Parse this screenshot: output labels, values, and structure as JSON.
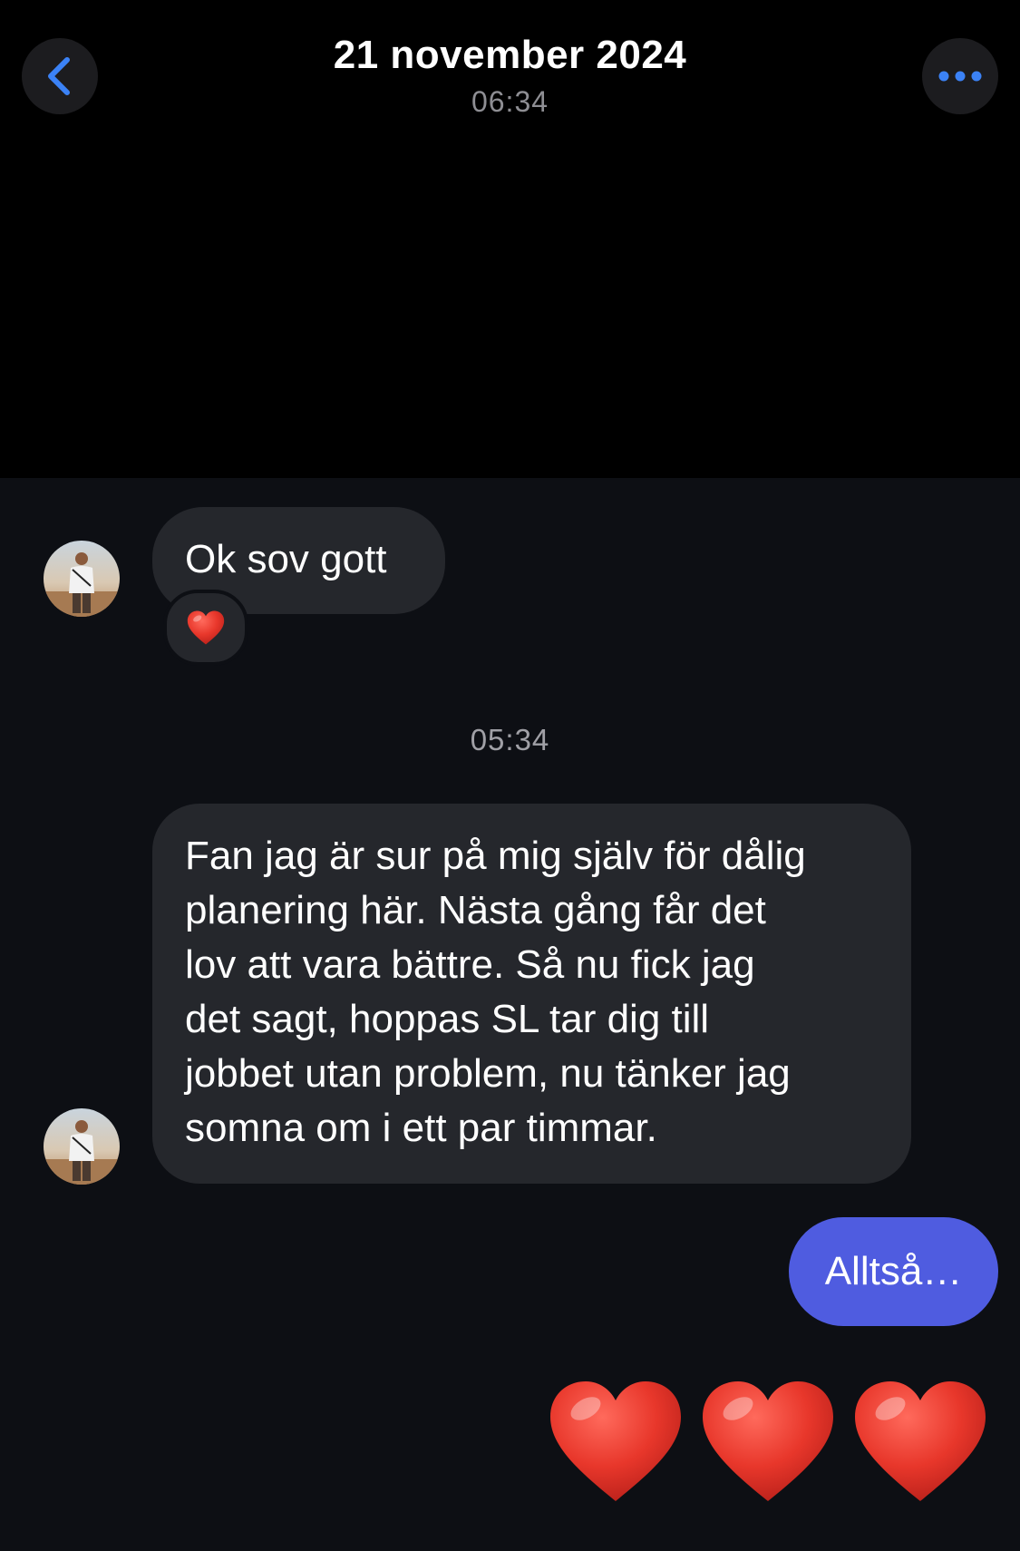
{
  "header": {
    "title": "21 november 2024",
    "time": "06:34",
    "back_icon": "chevron-left-icon",
    "more_icon": "ellipsis-icon",
    "accent_color": "#3b82f6"
  },
  "messages": [
    {
      "direction": "incoming",
      "text": "Ok sov gott",
      "reaction": "❤️"
    },
    {
      "type": "timestamp",
      "text": "05:34"
    },
    {
      "direction": "incoming",
      "lines": [
        "Fan jag är sur på mig själv för dålig",
        "planering här. Nästa gång får det",
        "lov att vara bättre. Så nu fick jag",
        "det sagt, hoppas SL tar dig till",
        "jobbet utan problem, nu tänker jag",
        "somna om i ett par timmar."
      ]
    },
    {
      "direction": "outgoing",
      "text": "Alltså…"
    },
    {
      "direction": "outgoing",
      "type": "emoji",
      "text": "❤️❤️❤️"
    }
  ],
  "colors": {
    "incoming_bubble": "#25272c",
    "outgoing_bubble": "#4f5ce0",
    "chat_background": "#0d0f14",
    "heart": "#e8372b"
  }
}
